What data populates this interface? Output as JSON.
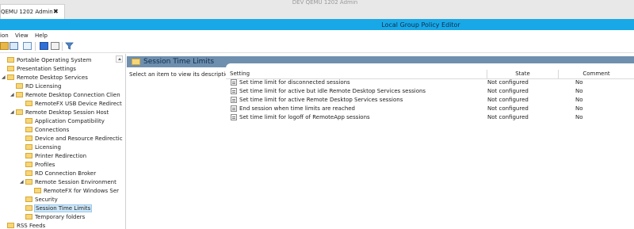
{
  "browser": {
    "vm_title": "DEV QEMU 1202 Admin",
    "tab_label": "QEMU 1202 Admin",
    "tab_close": "✖"
  },
  "window": {
    "title": "Local Group Policy Editor"
  },
  "menu": [
    "ion",
    "View",
    "Help"
  ],
  "tree": [
    {
      "label": "Portable Operating System",
      "twisty": "",
      "selected": false
    },
    {
      "label": "Presentation Settings",
      "twisty": "",
      "selected": false
    },
    {
      "label": "Remote Desktop Services",
      "twisty": "◢",
      "selected": false
    },
    {
      "label": "RD Licensing",
      "twisty": "",
      "selected": false
    },
    {
      "label": "Remote Desktop Connection Clien",
      "twisty": "◢",
      "selected": false
    },
    {
      "label": "RemoteFX USB Device Redirect",
      "twisty": "",
      "selected": false
    },
    {
      "label": "Remote Desktop Session Host",
      "twisty": "◢",
      "selected": false
    },
    {
      "label": "Application Compatibility",
      "twisty": "",
      "selected": false
    },
    {
      "label": "Connections",
      "twisty": "",
      "selected": false
    },
    {
      "label": "Device and Resource Redirectic",
      "twisty": "",
      "selected": false
    },
    {
      "label": "Licensing",
      "twisty": "",
      "selected": false
    },
    {
      "label": "Printer Redirection",
      "twisty": "",
      "selected": false
    },
    {
      "label": "Profiles",
      "twisty": "",
      "selected": false
    },
    {
      "label": "RD Connection Broker",
      "twisty": "",
      "selected": false
    },
    {
      "label": "Remote Session Environment",
      "twisty": "◢",
      "selected": false
    },
    {
      "label": "RemoteFX for Windows Ser",
      "twisty": "",
      "selected": false
    },
    {
      "label": "Security",
      "twisty": "",
      "selected": false
    },
    {
      "label": "Session Time Limits",
      "twisty": "",
      "selected": true
    },
    {
      "label": "Temporary folders",
      "twisty": "",
      "selected": false
    },
    {
      "label": "RSS Feeds",
      "twisty": "",
      "selected": false
    }
  ],
  "pane": {
    "title": "Session Time Limits",
    "description": "Select an item to view its description.",
    "columns": {
      "setting": "Setting",
      "state": "State",
      "comment": "Comment"
    },
    "rows": [
      {
        "setting": "Set time limit for disconnected sessions",
        "state": "Not configured",
        "comment": "No"
      },
      {
        "setting": "Set time limit for active but idle Remote Desktop Services sessions",
        "state": "Not configured",
        "comment": "No"
      },
      {
        "setting": "Set time limit for active Remote Desktop Services sessions",
        "state": "Not configured",
        "comment": "No"
      },
      {
        "setting": "End session when time limits are reached",
        "state": "Not configured",
        "comment": "No"
      },
      {
        "setting": "Set time limit for logoff of RemoteApp sessions",
        "state": "Not configured",
        "comment": "No"
      }
    ]
  },
  "icons": {
    "toolbar": [
      "back-icon",
      "properties-icon",
      "export-list-icon",
      "help-icon",
      "show-hide-icon",
      "filter-icon"
    ],
    "setting_row": "policy-setting-icon",
    "tree_item": "folder-icon"
  },
  "colors": {
    "title_bar": "#18a8e8",
    "pane_header": "#6f8faf",
    "selection": "#cde6f7",
    "folder": "#f6d67a"
  }
}
